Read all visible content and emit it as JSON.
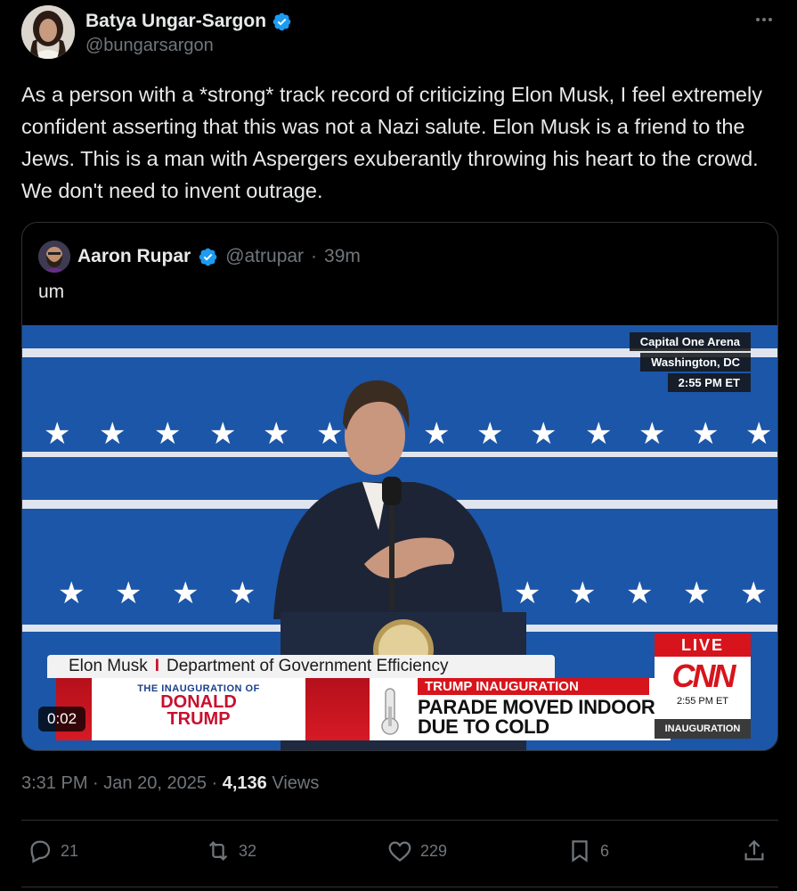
{
  "author": {
    "name": "Batya Ungar-Sargon",
    "handle": "@bungarsargon",
    "verified_icon": "verified-badge-icon",
    "more_icon": "more-dots-icon"
  },
  "tweet": {
    "text": "As a person with a *strong* track record of criticizing Elon Musk, I feel extremely confident asserting that this was not a Nazi salute. Elon Musk is a friend to the Jews. This is a man with Aspergers exuberantly throwing his heart to the crowd. We don't need to invent outrage."
  },
  "quote": {
    "name": "Aaron Rupar",
    "handle": "@atrupar",
    "dot": "·",
    "time": "39m",
    "text": "um",
    "video": {
      "location_lines": [
        "Capital One Arena",
        "Washington, DC",
        "2:55 PM ET"
      ],
      "chyron_name": "Elon Musk",
      "chyron_sep": "I",
      "chyron_title": "Department of Government Efficiency",
      "inaug_small": "THE INAUGURATION OF",
      "inaug_line1": "DONALD",
      "inaug_line2": "TRUMP",
      "headline_tag": "TRUMP INAUGURATION",
      "headline_line1": "PARADE MOVED INDOORS",
      "headline_line2": "DUE TO COLD",
      "live_label": "LIVE",
      "network": "CNN",
      "network_time": "2:55 PM ET",
      "network_tag": "INAUGURATION",
      "duration": "0:02",
      "colors": {
        "backdrop": "#1b56a8",
        "cnn_red": "#d7141c"
      }
    }
  },
  "meta": {
    "time": "3:31 PM",
    "sep1": "·",
    "date": "Jan 20, 2025",
    "sep2": "·",
    "views_count": "4,136",
    "views_label": "Views"
  },
  "actions": {
    "replies": "21",
    "reposts": "32",
    "likes": "229",
    "bookmarks": "6"
  },
  "colors": {
    "background": "#000000",
    "text": "#e7e9ea",
    "muted": "#71767b",
    "verified": "#1d9bf0"
  }
}
